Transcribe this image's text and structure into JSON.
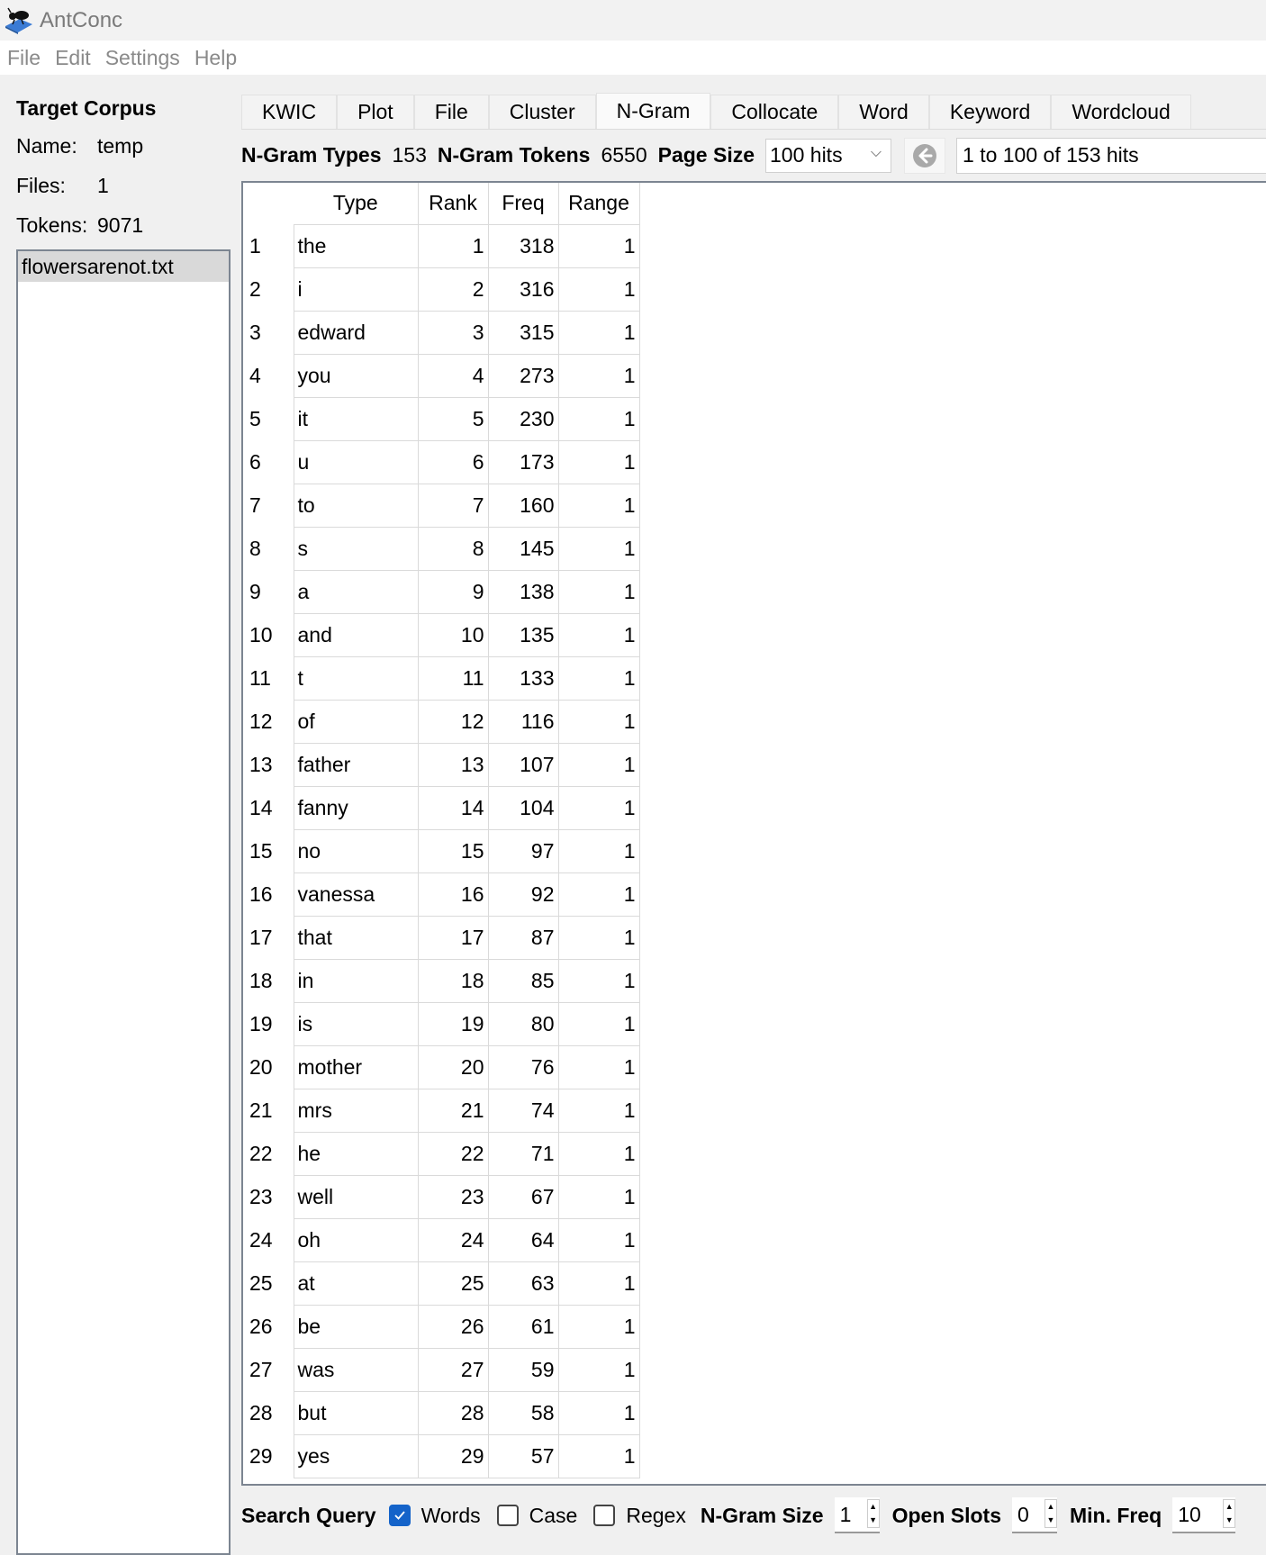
{
  "window": {
    "title": "AntConc"
  },
  "menu": [
    "File",
    "Edit",
    "Settings",
    "Help"
  ],
  "sidebar": {
    "title": "Target Corpus",
    "name_label": "Name:",
    "name_value": "temp",
    "files_label": "Files:",
    "files_value": "1",
    "tokens_label": "Tokens:",
    "tokens_value": "9071",
    "files": [
      "flowersarenot.txt"
    ]
  },
  "tabs": [
    {
      "label": "KWIC"
    },
    {
      "label": "Plot"
    },
    {
      "label": "File"
    },
    {
      "label": "Cluster"
    },
    {
      "label": "N-Gram",
      "active": true
    },
    {
      "label": "Collocate"
    },
    {
      "label": "Word"
    },
    {
      "label": "Keyword"
    },
    {
      "label": "Wordcloud"
    }
  ],
  "stats": {
    "types_label": "N-Gram Types",
    "types_value": "153",
    "tokens_label": "N-Gram Tokens",
    "tokens_value": "6550",
    "page_size_label": "Page Size",
    "page_size_value": "100 hits",
    "hits_text": "1 to 100 of 153 hits"
  },
  "table": {
    "columns": [
      "",
      "Type",
      "Rank",
      "Freq",
      "Range"
    ],
    "rows": [
      [
        "1",
        "the",
        "1",
        "318",
        "1"
      ],
      [
        "2",
        "i",
        "2",
        "316",
        "1"
      ],
      [
        "3",
        "edward",
        "3",
        "315",
        "1"
      ],
      [
        "4",
        "you",
        "4",
        "273",
        "1"
      ],
      [
        "5",
        "it",
        "5",
        "230",
        "1"
      ],
      [
        "6",
        "u",
        "6",
        "173",
        "1"
      ],
      [
        "7",
        "to",
        "7",
        "160",
        "1"
      ],
      [
        "8",
        "s",
        "8",
        "145",
        "1"
      ],
      [
        "9",
        "a",
        "9",
        "138",
        "1"
      ],
      [
        "10",
        "and",
        "10",
        "135",
        "1"
      ],
      [
        "11",
        "t",
        "11",
        "133",
        "1"
      ],
      [
        "12",
        "of",
        "12",
        "116",
        "1"
      ],
      [
        "13",
        "father",
        "13",
        "107",
        "1"
      ],
      [
        "14",
        "fanny",
        "14",
        "104",
        "1"
      ],
      [
        "15",
        "no",
        "15",
        "97",
        "1"
      ],
      [
        "16",
        "vanessa",
        "16",
        "92",
        "1"
      ],
      [
        "17",
        "that",
        "17",
        "87",
        "1"
      ],
      [
        "18",
        "in",
        "18",
        "85",
        "1"
      ],
      [
        "19",
        "is",
        "19",
        "80",
        "1"
      ],
      [
        "20",
        "mother",
        "20",
        "76",
        "1"
      ],
      [
        "21",
        "mrs",
        "21",
        "74",
        "1"
      ],
      [
        "22",
        "he",
        "22",
        "71",
        "1"
      ],
      [
        "23",
        "well",
        "23",
        "67",
        "1"
      ],
      [
        "24",
        "oh",
        "24",
        "64",
        "1"
      ],
      [
        "25",
        "at",
        "25",
        "63",
        "1"
      ],
      [
        "26",
        "be",
        "26",
        "61",
        "1"
      ],
      [
        "27",
        "was",
        "27",
        "59",
        "1"
      ],
      [
        "28",
        "but",
        "28",
        "58",
        "1"
      ],
      [
        "29",
        "yes",
        "29",
        "57",
        "1"
      ]
    ]
  },
  "search": {
    "label": "Search Query",
    "words_label": "Words",
    "words_checked": true,
    "case_label": "Case",
    "case_checked": false,
    "regex_label": "Regex",
    "regex_checked": false,
    "ngram_size_label": "N-Gram Size",
    "ngram_size_value": "1",
    "open_slots_label": "Open Slots",
    "open_slots_value": "0",
    "min_freq_label": "Min. Freq",
    "min_freq_value": "10"
  }
}
